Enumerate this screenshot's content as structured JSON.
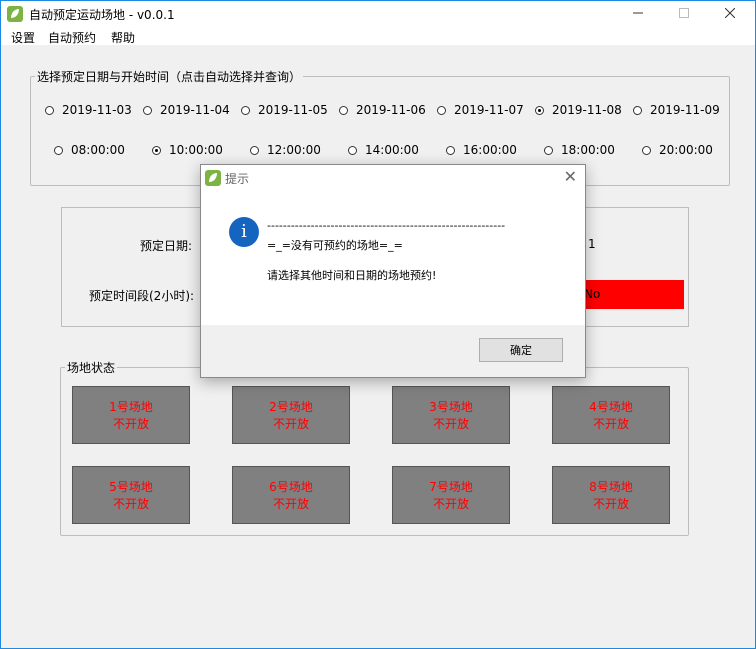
{
  "window": {
    "title": "自动预定运动场地 - v0.0.1",
    "min_icon": "minimize-icon",
    "max_icon": "maximize-icon",
    "close_icon": "close-icon"
  },
  "menu": [
    "设置",
    "自动预约",
    "帮助"
  ],
  "date_group": {
    "legend": "选择预定日期与开始时间（点击自动选择并查询）",
    "dates": [
      "2019-11-03",
      "2019-11-04",
      "2019-11-05",
      "2019-11-06",
      "2019-11-07",
      "2019-11-08",
      "2019-11-09"
    ],
    "selected_date": "2019-11-08",
    "times": [
      "08:00:00",
      "10:00:00",
      "12:00:00",
      "14:00:00",
      "16:00:00",
      "18:00:00",
      "20:00:00"
    ],
    "selected_time": "10:00:00"
  },
  "booking": {
    "date_label": "预定日期:",
    "date_value_partial": "1",
    "time_label": "预定时间段(2小时):",
    "status_value_partial": "No",
    "status_color": "#ff0000"
  },
  "venues": {
    "legend": "场地状态",
    "items": [
      {
        "name": "1号场地",
        "status": "不开放"
      },
      {
        "name": "2号场地",
        "status": "不开放"
      },
      {
        "name": "3号场地",
        "status": "不开放"
      },
      {
        "name": "4号场地",
        "status": "不开放"
      },
      {
        "name": "5号场地",
        "status": "不开放"
      },
      {
        "name": "6号场地",
        "status": "不开放"
      },
      {
        "name": "7号场地",
        "status": "不开放"
      },
      {
        "name": "8号场地",
        "status": "不开放"
      }
    ]
  },
  "dialog": {
    "title": "提示",
    "icon": "info-icon",
    "line1": "------------------------------------------------------------",
    "line2": "=_=没有可预约的场地=_=",
    "line3": "请选择其他时间和日期的场地预约!",
    "ok_label": "确定"
  }
}
